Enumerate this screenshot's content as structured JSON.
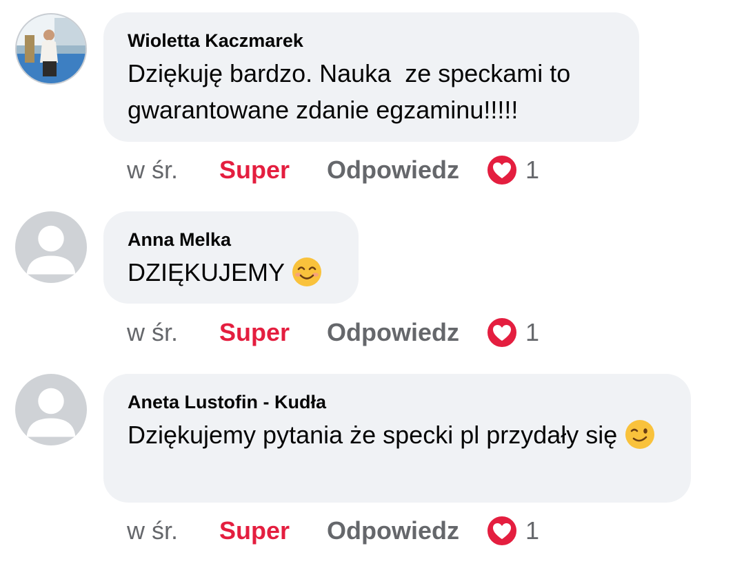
{
  "comments": [
    {
      "author": "Wioletta Kaczmarek",
      "text": "Dziękuję bardzo. Nauka  ze speckami to gwarantowane zdanie egzaminu!!!!!",
      "avatar": "photo-avatar",
      "time": "w śr.",
      "like_label": "Super",
      "reply_label": "Odpowiedz",
      "reaction_icon": "heart-icon",
      "reaction_count": "1"
    },
    {
      "author": "Anna Melka",
      "text": "DZIĘKUJEMY ",
      "emoji": "smiling-face-emoji",
      "avatar": "default-avatar",
      "time": "w śr.",
      "like_label": "Super",
      "reply_label": "Odpowiedz",
      "reaction_icon": "heart-icon",
      "reaction_count": "1"
    },
    {
      "author": "Aneta Lustofin - Kudła",
      "text": "Dziękujemy pytania że specki pl przydały się ",
      "emoji": "winking-face-emoji",
      "avatar": "default-avatar",
      "time": "w śr.",
      "like_label": "Super",
      "reply_label": "Odpowiedz",
      "reaction_icon": "heart-icon",
      "reaction_count": "1"
    }
  ],
  "colors": {
    "bubble_bg": "#f0f2f5",
    "like_red": "#e41e3f",
    "muted_gray": "#65676b"
  }
}
